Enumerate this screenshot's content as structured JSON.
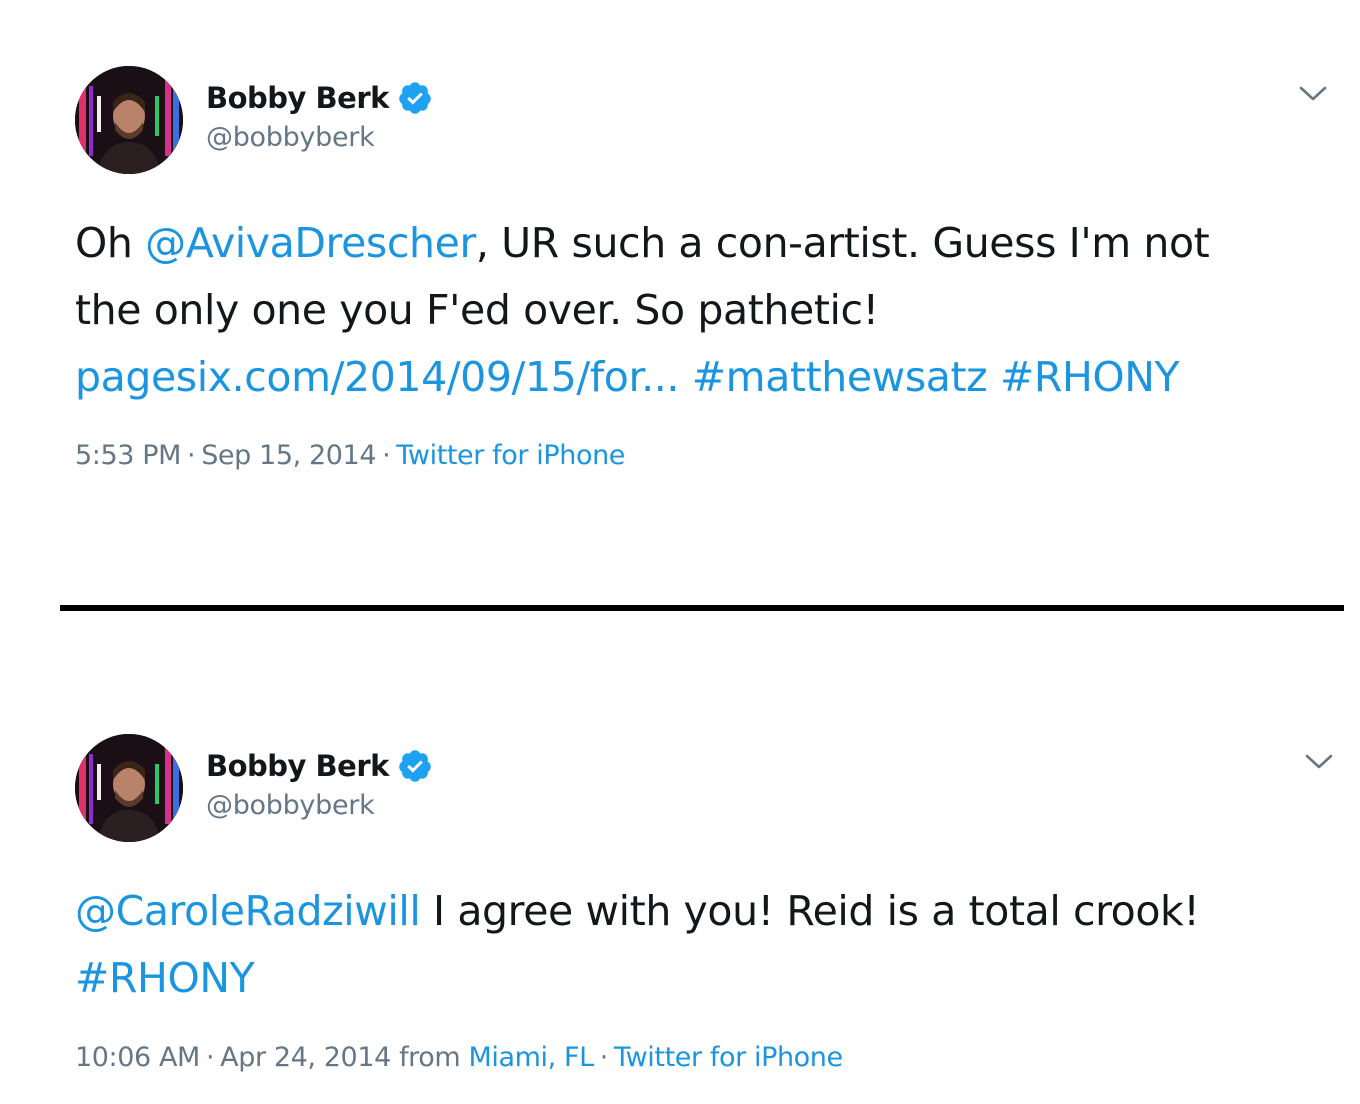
{
  "colors": {
    "link": "#1b95e0",
    "secondary_text": "#657786",
    "primary_text": "#14171a",
    "verified_badge": "#1da1f2",
    "divider": "#000000"
  },
  "tweets": [
    {
      "author": {
        "name": "Bobby Berk",
        "handle": "@bobbyberk",
        "verified": true
      },
      "text": {
        "mention": "@AvivaDrescher",
        "part1": ", UR such a con-artist. Guess I'm not",
        "part0": "Oh ",
        "line2": "the only one you F'ed over. So pathetic!",
        "link": "pagesix.com/2014/09/15/for...",
        "hashtag1": "#matthewsatz",
        "hashtag2": "#RHONY"
      },
      "meta": {
        "time": "5:53 PM",
        "date": "Sep 15, 2014",
        "source": "Twitter for iPhone"
      }
    },
    {
      "author": {
        "name": "Bobby Berk",
        "handle": "@bobbyberk",
        "verified": true
      },
      "text": {
        "mention": "@CaroleRadziwill",
        "part1": " I agree with you! Reid is a total crook!",
        "hashtag1": "#RHONY"
      },
      "meta": {
        "time": "10:06 AM",
        "date": "Apr 24, 2014",
        "from_label": "from",
        "location": "Miami, FL",
        "source": "Twitter for iPhone"
      }
    }
  ],
  "icons": {
    "verified": "verified-badge-icon",
    "caret": "chevron-down-icon"
  }
}
